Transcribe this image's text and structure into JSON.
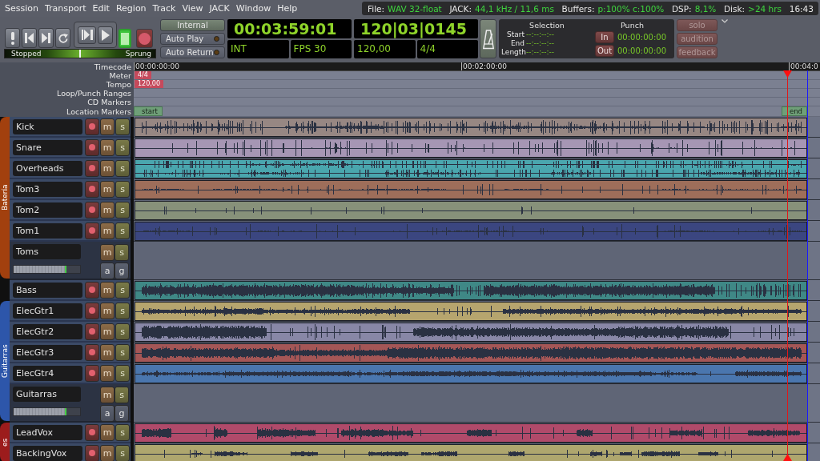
{
  "menu_bar": {
    "items": [
      "Session",
      "Transport",
      "Edit",
      "Region",
      "Track",
      "View",
      "JACK",
      "Window",
      "Help"
    ]
  },
  "status_bar": {
    "fields": [
      {
        "label": "File:",
        "value": "WAV 32-float"
      },
      {
        "label": "JACK:",
        "value": "44,1 kHz / 11,6 ms"
      },
      {
        "label": "Buffers:",
        "value": "p:100% c:100%"
      },
      {
        "label": "DSP:",
        "value": "8,1%"
      },
      {
        "label": "Disk:",
        "value": ">24 hrs"
      }
    ],
    "time": "16:43"
  },
  "transport": {
    "buttons": [
      {
        "kind": "alert",
        "active": false
      },
      {
        "kind": "start",
        "active": false
      },
      {
        "kind": "end",
        "active": false
      },
      {
        "kind": "loop",
        "active": false
      },
      {
        "kind": "play_range",
        "active": false
      },
      {
        "kind": "play",
        "active": false
      },
      {
        "kind": "stop",
        "active": true
      },
      {
        "kind": "record",
        "active": false
      }
    ],
    "shuttle": {
      "status": "Stopped",
      "mode": "Sprung",
      "level": 0.5
    }
  },
  "options": [
    {
      "kind": "sync",
      "label": "Internal"
    },
    {
      "kind": "toggle",
      "label": "Auto Play",
      "on": false
    },
    {
      "kind": "toggle",
      "label": "Auto Return",
      "on": false
    }
  ],
  "primary_clock": {
    "time": "00:03:59:01",
    "source": "INT",
    "rate": "FPS 30"
  },
  "secondary_clock": {
    "time": "120|03|0145",
    "tempo": "120,00",
    "meter": "4/4"
  },
  "metronome": {
    "on": false
  },
  "selection": {
    "title": "Selection",
    "rows": [
      {
        "label": "Start",
        "value": "--:--:--:--"
      },
      {
        "label": "End",
        "value": "--:--:--:--"
      },
      {
        "label": "Length",
        "value": "--:--:--:--"
      }
    ]
  },
  "punch": {
    "title": "Punch",
    "rows": [
      {
        "button": "In",
        "value": "00:00:00:00"
      },
      {
        "button": "Out",
        "value": "00:00:00:00"
      }
    ]
  },
  "monitor_buttons": [
    "solo",
    "audition",
    "feedback"
  ],
  "rulers": [
    {
      "kind": "timecode",
      "label": "Timecode",
      "marks": [
        "00:00:00:00",
        "00:02:00:00",
        "00:04:0"
      ]
    },
    {
      "kind": "meter",
      "label": "Meter",
      "marks": [
        "4/4"
      ]
    },
    {
      "kind": "tempo",
      "label": "Tempo",
      "marks": [
        "120,00"
      ]
    },
    {
      "kind": "loop",
      "label": "Loop/Punch Ranges"
    },
    {
      "kind": "cd",
      "label": "CD Markers"
    },
    {
      "kind": "location",
      "label": "Location Markers",
      "marks": [
        "start",
        "end"
      ]
    }
  ],
  "tracks": [
    {
      "kind": "group",
      "name": "Batería",
      "color": "#a2400e",
      "children": [
        {
          "kind": "audio",
          "name": "Kick",
          "color": "#978783",
          "stereo": false,
          "armed": false,
          "buttons": [
            {
              "kind": "mute",
              "label": "m",
              "on": false
            },
            {
              "kind": "solo",
              "label": "s",
              "on": false
            }
          ]
        },
        {
          "kind": "audio",
          "name": "Snare",
          "color": "#a696b4",
          "stereo": false,
          "armed": false,
          "buttons": [
            {
              "kind": "mute",
              "label": "m",
              "on": false
            },
            {
              "kind": "solo",
              "label": "s",
              "on": false
            }
          ]
        },
        {
          "kind": "audio",
          "name": "Overheads",
          "color": "#4aa6ae",
          "stereo": true,
          "armed": false,
          "buttons": [
            {
              "kind": "mute",
              "label": "m",
              "on": false
            },
            {
              "kind": "solo",
              "label": "s",
              "on": false
            }
          ]
        },
        {
          "kind": "audio",
          "name": "Tom3",
          "color": "#9e6e5a",
          "stereo": false,
          "armed": false,
          "buttons": [
            {
              "kind": "mute",
              "label": "m",
              "on": false
            },
            {
              "kind": "solo",
              "label": "s",
              "on": false
            }
          ]
        },
        {
          "kind": "audio",
          "name": "Tom2",
          "color": "#87917a",
          "stereo": false,
          "armed": false,
          "buttons": [
            {
              "kind": "mute",
              "label": "m",
              "on": false
            },
            {
              "kind": "solo",
              "label": "s",
              "on": false
            }
          ]
        },
        {
          "kind": "audio",
          "name": "Tom1",
          "color": "#3b4680",
          "stereo": false,
          "armed": false,
          "buttons": [
            {
              "kind": "mute",
              "label": "m",
              "on": false
            },
            {
              "kind": "solo",
              "label": "s",
              "on": false
            }
          ]
        },
        {
          "kind": "bus",
          "name": "Toms",
          "level": 0.79,
          "buttons": [
            {
              "kind": "mute",
              "label": "m",
              "on": false
            },
            {
              "kind": "solo",
              "label": "s",
              "on": false
            },
            {
              "kind": "automation",
              "label": "a",
              "on": false
            },
            {
              "kind": "group",
              "label": "g",
              "on": false
            }
          ]
        }
      ]
    },
    {
      "kind": "audio",
      "name": "Bass",
      "color": "#3f8886",
      "stereo": false,
      "armed": false,
      "buttons": [
        {
          "kind": "mute",
          "label": "m",
          "on": false
        },
        {
          "kind": "solo",
          "label": "s",
          "on": false
        }
      ]
    },
    {
      "kind": "group",
      "name": "Guitarras",
      "color": "#2d56aa",
      "children": [
        {
          "kind": "audio",
          "name": "ElecGtr1",
          "color": "#b6a56e",
          "stereo": false,
          "armed": false,
          "buttons": [
            {
              "kind": "mute",
              "label": "m",
              "on": false
            },
            {
              "kind": "solo",
              "label": "s",
              "on": false
            }
          ]
        },
        {
          "kind": "audio",
          "name": "ElecGtr2",
          "color": "#8887a6",
          "stereo": false,
          "armed": false,
          "buttons": [
            {
              "kind": "mute",
              "label": "m",
              "on": false
            },
            {
              "kind": "solo",
              "label": "s",
              "on": false
            }
          ]
        },
        {
          "kind": "audio",
          "name": "ElecGtr3",
          "color": "#a45656",
          "stereo": false,
          "armed": false,
          "buttons": [
            {
              "kind": "mute",
              "label": "m",
              "on": false
            },
            {
              "kind": "solo",
              "label": "s",
              "on": false
            }
          ]
        },
        {
          "kind": "audio",
          "name": "ElecGtr4",
          "color": "#4a76ae",
          "stereo": false,
          "armed": false,
          "buttons": [
            {
              "kind": "mute",
              "label": "m",
              "on": false
            },
            {
              "kind": "solo",
              "label": "s",
              "on": false
            }
          ]
        },
        {
          "kind": "bus",
          "name": "Guitarras",
          "level": 0.79,
          "buttons": [
            {
              "kind": "mute",
              "label": "m",
              "on": false
            },
            {
              "kind": "solo",
              "label": "s",
              "on": false
            },
            {
              "kind": "automation",
              "label": "a",
              "on": false
            },
            {
              "kind": "group",
              "label": "g",
              "on": false
            }
          ]
        }
      ]
    },
    {
      "kind": "group",
      "name": "es",
      "color": "#9c1c1c",
      "children": [
        {
          "kind": "audio",
          "name": "LeadVox",
          "color": "#b04a6a",
          "stereo": false,
          "armed": false,
          "buttons": [
            {
              "kind": "mute",
              "label": "m",
              "on": false
            },
            {
              "kind": "solo",
              "label": "s",
              "on": false
            }
          ]
        },
        {
          "kind": "audio",
          "name": "BackingVox",
          "color": "#aea66e",
          "stereo": false,
          "armed": false,
          "buttons": [
            {
              "kind": "mute",
              "label": "m",
              "on": false
            },
            {
              "kind": "solo",
              "label": "s",
              "on": false
            }
          ]
        }
      ]
    }
  ]
}
